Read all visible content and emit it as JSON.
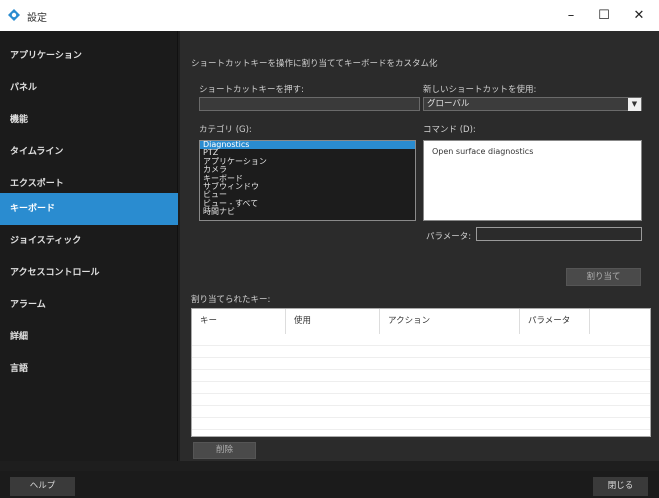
{
  "window": {
    "title": "設定",
    "minimize": "–",
    "maximize": "☐",
    "close": "✕",
    "icon": "app-diamond-icon",
    "accent": "#2a8cd0"
  },
  "sidebar": {
    "items": [
      {
        "label": "アプリケーション"
      },
      {
        "label": "パネル"
      },
      {
        "label": "機能"
      },
      {
        "label": "タイムライン"
      },
      {
        "label": "エクスポート"
      },
      {
        "label": "キーボード"
      },
      {
        "label": "ジョイスティック"
      },
      {
        "label": "アクセスコントロール"
      },
      {
        "label": "アラーム"
      },
      {
        "label": "詳細"
      },
      {
        "label": "言語"
      }
    ],
    "active": "キーボード"
  },
  "main": {
    "heading": "ショートカットキーを操作に割り当ててキーボードをカスタム化",
    "shortcut_label": "ショートカットキーを押す:",
    "shortcut_value": "",
    "use_new_label": "新しいショートカットを使用:",
    "use_new_value": "グローバル",
    "category_label": "カテゴリ (G):",
    "categories": [
      {
        "label": "Diagnostics"
      },
      {
        "label": "PTZ"
      },
      {
        "label": "アプリケーション"
      },
      {
        "label": "カメラ"
      },
      {
        "label": "キーボード"
      },
      {
        "label": "サブウィンドウ"
      },
      {
        "label": "ビュー"
      },
      {
        "label": "ビュー - すべて"
      },
      {
        "label": "時間ナビ"
      }
    ],
    "command_label": "コマンド (D):",
    "commands": [
      {
        "label": "Open surface diagnostics"
      }
    ],
    "parameter_label": "パラメータ:",
    "parameter_value": "",
    "assign_button": "割り当て",
    "assigned_label": "割り当てられたキー:",
    "table_headers": [
      "キー",
      "使用",
      "アクション",
      "パラメータ"
    ],
    "delete_button": "削除"
  },
  "footer": {
    "help_button": "ヘルプ",
    "close_button": "閉じる"
  }
}
